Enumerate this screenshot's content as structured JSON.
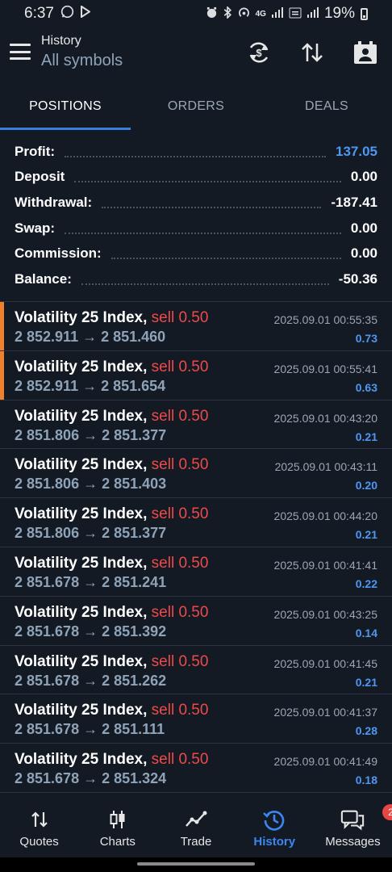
{
  "status_bar": {
    "time": "6:37",
    "battery": "19%",
    "network": "4G"
  },
  "header": {
    "title": "History",
    "subtitle": "All symbols"
  },
  "tabs": [
    {
      "label": "POSITIONS",
      "active": true
    },
    {
      "label": "ORDERS",
      "active": false
    },
    {
      "label": "DEALS",
      "active": false
    }
  ],
  "summary": [
    {
      "label": "Profit:",
      "value": "137.05"
    },
    {
      "label": "Deposit",
      "value": "0.00"
    },
    {
      "label": "Withdrawal:",
      "value": "-187.41"
    },
    {
      "label": "Swap:",
      "value": "0.00"
    },
    {
      "label": "Commission:",
      "value": "0.00"
    },
    {
      "label": "Balance:",
      "value": "-50.36"
    }
  ],
  "deals": [
    {
      "symbol": "Volatility 25 Index,",
      "type": "sell 0.50",
      "prices": "2 852.911 → 2 851.460",
      "time": "2025.09.01 00:55:35",
      "profit": "0.73"
    },
    {
      "symbol": "Volatility 25 Index,",
      "type": "sell 0.50",
      "prices": "2 852.911 → 2 851.654",
      "time": "2025.09.01 00:55:41",
      "profit": "0.63"
    },
    {
      "symbol": "Volatility 25 Index,",
      "type": "sell 0.50",
      "prices": "2 851.806 → 2 851.377",
      "time": "2025.09.01 00:43:20",
      "profit": "0.21"
    },
    {
      "symbol": "Volatility 25 Index,",
      "type": "sell 0.50",
      "prices": "2 851.806 → 2 851.403",
      "time": "2025.09.01 00:43:11",
      "profit": "0.20"
    },
    {
      "symbol": "Volatility 25 Index,",
      "type": "sell 0.50",
      "prices": "2 851.806 → 2 851.377",
      "time": "2025.09.01 00:44:20",
      "profit": "0.21"
    },
    {
      "symbol": "Volatility 25 Index,",
      "type": "sell 0.50",
      "prices": "2 851.678 → 2 851.241",
      "time": "2025.09.01 00:41:41",
      "profit": "0.22"
    },
    {
      "symbol": "Volatility 25 Index,",
      "type": "sell 0.50",
      "prices": "2 851.678 → 2 851.392",
      "time": "2025.09.01 00:43:25",
      "profit": "0.14"
    },
    {
      "symbol": "Volatility 25 Index,",
      "type": "sell 0.50",
      "prices": "2 851.678 → 2 851.262",
      "time": "2025.09.01 00:41:45",
      "profit": "0.21"
    },
    {
      "symbol": "Volatility 25 Index,",
      "type": "sell 0.50",
      "prices": "2 851.678 → 2 851.111",
      "time": "2025.09.01 00:41:37",
      "profit": "0.28"
    },
    {
      "symbol": "Volatility 25 Index,",
      "type": "sell 0.50",
      "prices": "2 851.678 → 2 851.324",
      "time": "2025.09.01 00:41:49",
      "profit": "0.18"
    }
  ],
  "bottom_nav": [
    {
      "label": "Quotes",
      "icon": "quotes-icon"
    },
    {
      "label": "Charts",
      "icon": "charts-icon"
    },
    {
      "label": "Trade",
      "icon": "trade-icon"
    },
    {
      "label": "History",
      "icon": "history-icon",
      "active": true
    },
    {
      "label": "Messages",
      "icon": "messages-icon",
      "badge": "2"
    }
  ],
  "colors": {
    "background": "#131a24",
    "accent": "#3b7ee0",
    "profit": "#4e97f2",
    "sell": "#ef4a4a",
    "marker": "#f0802a"
  }
}
